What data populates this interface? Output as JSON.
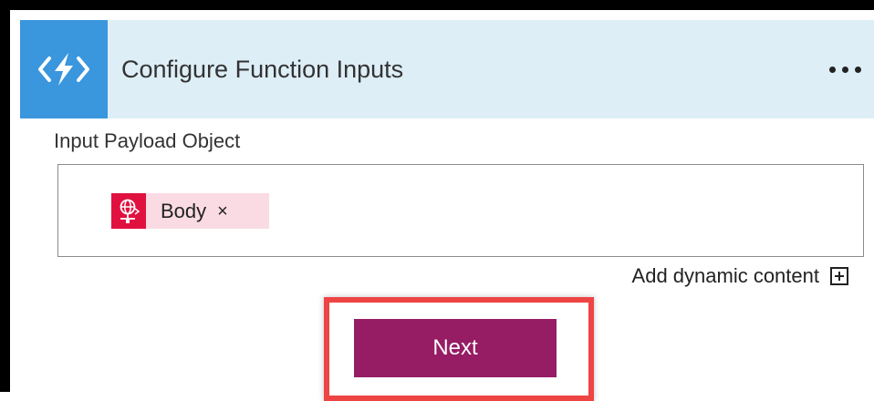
{
  "header": {
    "title": "Configure Function Inputs",
    "icon": "azure-function-icon",
    "more_menu_icon": "ellipsis-icon"
  },
  "payload": {
    "label": "Input Payload Object",
    "token": {
      "label": "Body",
      "remove_label": "×",
      "icon": "http-request-icon"
    }
  },
  "dynamic_content": {
    "label": "Add dynamic content",
    "icon": "add-box-icon"
  },
  "actions": {
    "next_label": "Next"
  },
  "colors": {
    "header_bg": "#ddeef7",
    "function_icon_bg": "#3a96dd",
    "token_bg": "#fadbe4",
    "token_icon_bg": "#e0113f",
    "next_button_bg": "#961c64",
    "highlight_border": "#ee4444"
  }
}
